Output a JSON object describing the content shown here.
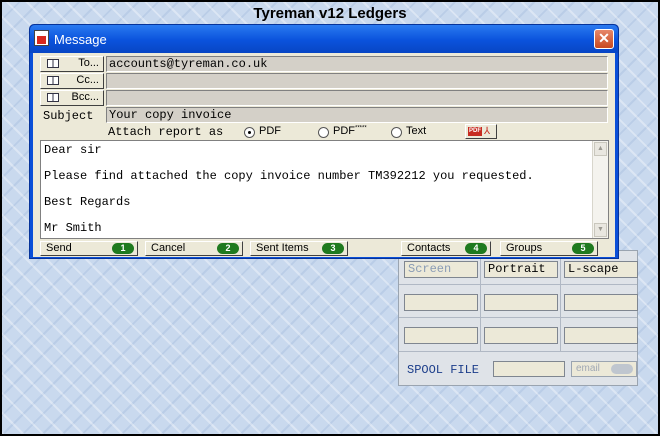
{
  "app": {
    "title": "Tyreman v12 Ledgers"
  },
  "dialog": {
    "title": "Message",
    "close_glyph": "✕",
    "to": {
      "button_label": "To...",
      "value": "accounts@tyreman.co.uk"
    },
    "cc": {
      "button_label": "Cc...",
      "value": ""
    },
    "bcc": {
      "button_label": "Bcc...",
      "value": ""
    },
    "subject": {
      "label": "Subject",
      "value": "Your copy invoice"
    },
    "attach": {
      "label": "Attach report as",
      "options": [
        {
          "label": "PDF",
          "selected": true
        },
        {
          "label": "PDF",
          "sup": "*****",
          "selected": false
        },
        {
          "label": "Text",
          "selected": false
        }
      ],
      "pdf_button_text": "PDF"
    },
    "body_lines": [
      "Dear sir",
      "Please find attached the copy invoice number TM392212 you requested.",
      "Best Regards",
      "Mr Smith"
    ],
    "buttons": [
      {
        "label": "Send",
        "key": "1"
      },
      {
        "label": "Cancel",
        "key": "2"
      },
      {
        "label": "Sent Items",
        "key": "3"
      },
      {
        "label": "Contacts",
        "key": "4"
      },
      {
        "label": "Groups",
        "key": "5"
      }
    ]
  },
  "background_panel": {
    "cells": [
      "Screen",
      "Portrait",
      "L-scape"
    ],
    "spool_label": "SPOOL FILE",
    "email_label": "email"
  },
  "colors": {
    "titlebar": "#0a52dc",
    "key_badge": "#1f7a1f",
    "window_face": "#ece9d8"
  }
}
